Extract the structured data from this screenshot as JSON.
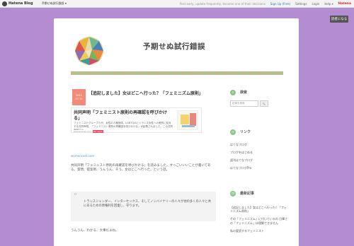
{
  "topbar": {
    "brand": "Hatena Blog",
    "blog_select": "予期せぬ試行錯誤 ▾",
    "tip": "Post early, update frequently, become one of their decisions",
    "sign_up": "Sign Up (Free)",
    "settings": "Settings",
    "login": "Login",
    "help": "Help ▾",
    "hatena": "Hatena"
  },
  "read_button": "読者になる",
  "site": {
    "title": "予期せぬ試行錯誤"
  },
  "article": {
    "date_line1": "2021",
    "date_line2": "07-14",
    "title": "【追記しました】女はどこへ行った？「フェミニズム原則」",
    "embed": {
      "title": "共同声明「フェミニスト原則の再確認を呼びかける」",
      "desc": "フェミニストグループらが、女性の人権団体、LGBTQIAとトランス女性への差別に反対する共同声明、「フェミニスト原則の再確認を呼びかける」が起草されました。この共同声明では……",
      "source": "womensnet.com",
      "bookmarks": "84 users"
    },
    "permalink": "womensnet.com",
    "body": "共同声明「フェミニスト原則の再確認を呼びかける」を読みました。すっごいいいことが書いてある。質問、提案例、うんうん、そう。女はどこへ行った。という話。",
    "quote": "トランスジェンダー、インターセックス、そしてノンバイナリーの人々が他の多くの人々と共にあるための原権利を回復し、守ります。",
    "after_quote": "うんうん、わかる、大事だよね。"
  },
  "sidebar": {
    "search": {
      "heading": "検索",
      "placeholder": "記事を検索",
      "button": "🔍"
    },
    "links": {
      "heading": "リンク",
      "items": [
        "はてなブログ",
        "ブログをはじめる",
        "週刊はてなブログ",
        "はてなブログPro"
      ]
    },
    "recent": {
      "heading": "最新記事",
      "items": [
        "【追記しました】女はどこへ行った？「フェミニズム原則」",
        "その「フェミニズム」に付いているの 日輝さの「フェミニズム」は理解できません",
        "私の愛読するフェミニスト"
      ]
    }
  }
}
